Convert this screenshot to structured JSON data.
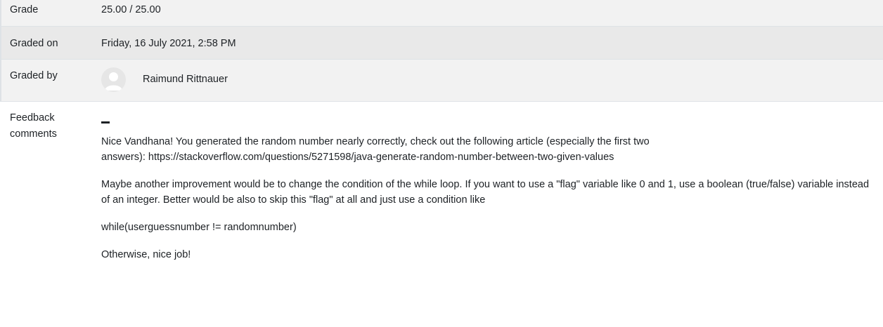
{
  "grade": {
    "label": "Grade",
    "value": "25.00 / 25.00"
  },
  "graded_on": {
    "label": "Graded on",
    "value": "Friday, 16 July 2021, 2:58 PM"
  },
  "graded_by": {
    "label": "Graded by",
    "avatar_icon": "user-avatar-icon",
    "name": "Raimund Rittnauer"
  },
  "feedback": {
    "label_line1": "Feedback",
    "label_line2": "comments",
    "paragraphs": [
      "Nice Vandhana! You generated the random number nearly correctly, check out the following article (especially the first two answers): https://stackoverflow.com/questions/5271598/java-generate-random-number-between-two-given-values",
      "Maybe another improvement would be to change the condition of the while loop. If you want to use a \"flag\" variable like 0 and 1, use a boolean (true/false) variable instead of an integer. Better would be also to skip this \"flag\" at all and just use a condition like",
      "while(userguessnumber != randomnumber)",
      "Otherwise, nice job!"
    ]
  }
}
